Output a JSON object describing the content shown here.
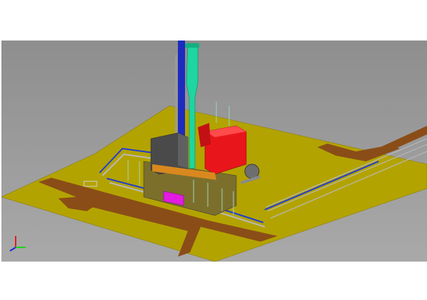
{
  "viewport": {
    "background_top": "#8e8e8e",
    "background_bottom": "#a9a9a9"
  },
  "model": {
    "ground_color": "#b3a300",
    "road_color": "#8a4d17",
    "stack_color": "#1d2bbf",
    "tower_color": "#1ed6a0",
    "boiler_color": "#e8161b",
    "housing_color": "#4a4a4a",
    "skid_color": "#e21ce0",
    "pipe_color": "#1f3cd6",
    "steel_color": "#b8b8b8"
  },
  "orientation_triad": {
    "icon": "xyz-axis-triad-icon",
    "axis_x_color": "#1ed31e",
    "axis_y_color": "#1f2bd6",
    "axis_z_color": "#e21c1c"
  }
}
